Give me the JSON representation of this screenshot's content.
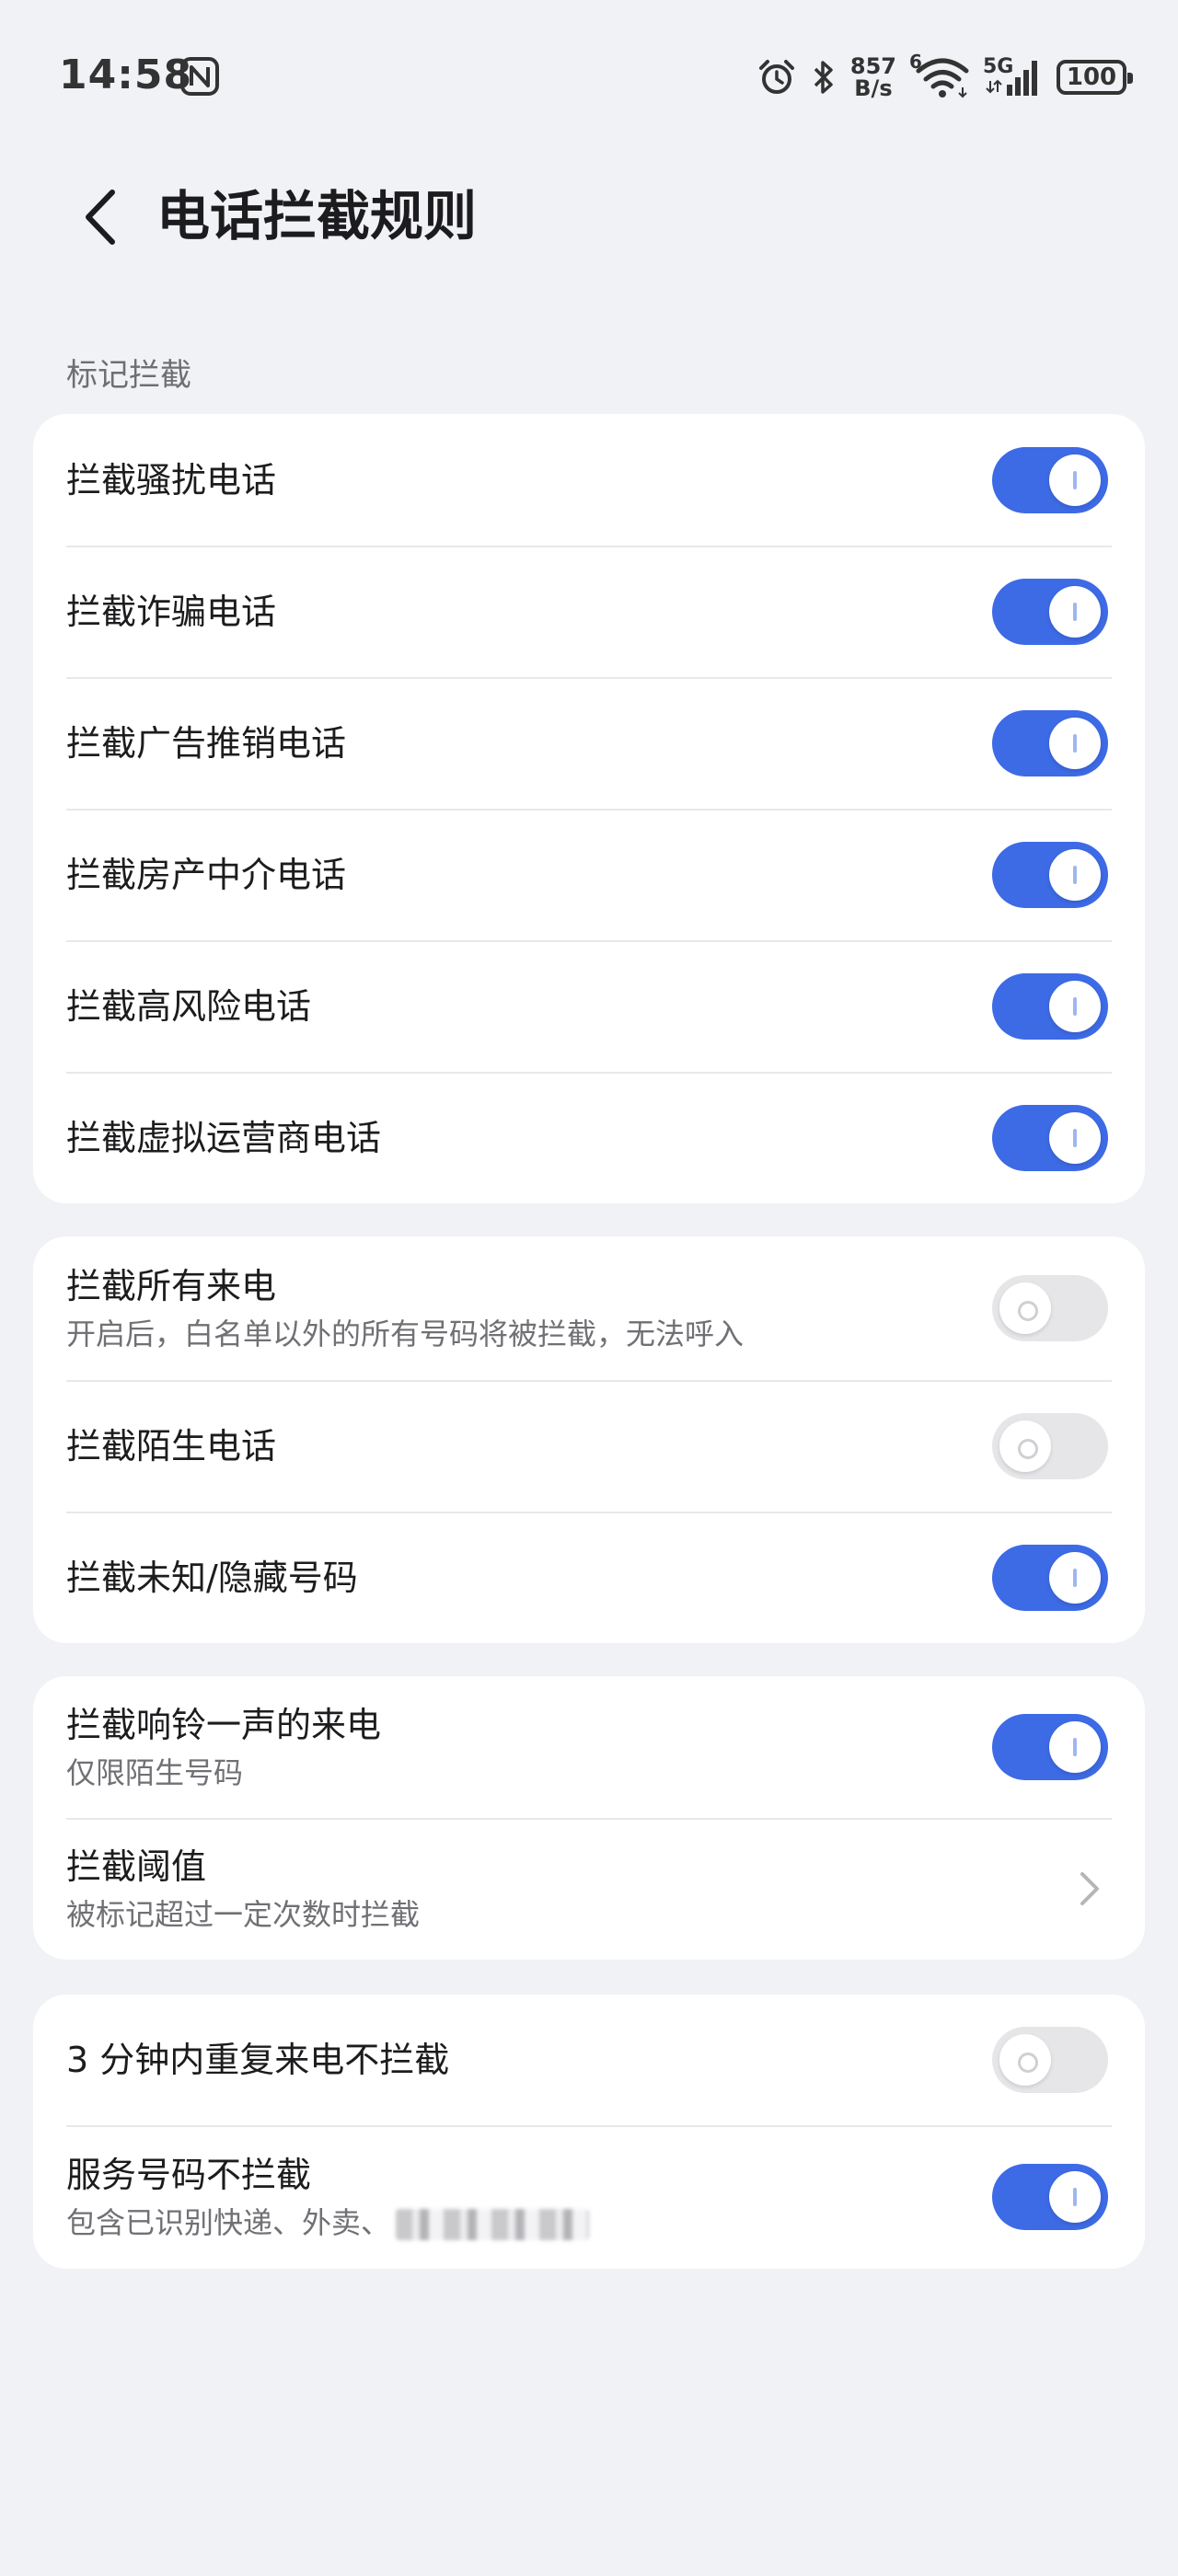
{
  "status_bar": {
    "time": "14:58",
    "net_speed_value": "857",
    "net_speed_unit": "B/s",
    "wifi_badge": "6",
    "mobile_badge": "5G",
    "battery": "100"
  },
  "header": {
    "title": "电话拦截规则"
  },
  "section_label": "标记拦截",
  "card1": {
    "items": [
      {
        "label": "拦截骚扰电话",
        "on": true
      },
      {
        "label": "拦截诈骗电话",
        "on": true
      },
      {
        "label": "拦截广告推销电话",
        "on": true
      },
      {
        "label": "拦截房产中介电话",
        "on": true
      },
      {
        "label": "拦截高风险电话",
        "on": true
      },
      {
        "label": "拦截虚拟运营商电话",
        "on": true
      }
    ]
  },
  "card2": {
    "all_calls": {
      "label": "拦截所有来电",
      "sub": "开启后，白名单以外的所有号码将被拦截，无法呼入",
      "on": false
    },
    "strangers": {
      "label": "拦截陌生电话",
      "on": false
    },
    "unknown": {
      "label": "拦截未知/隐藏号码",
      "on": true
    }
  },
  "card3": {
    "one_ring": {
      "label": "拦截响铃一声的来电",
      "sub": "仅限陌生号码",
      "on": true
    },
    "threshold": {
      "label": "拦截阈值",
      "sub": "被标记超过一定次数时拦截"
    }
  },
  "card4": {
    "repeat": {
      "label": "3 分钟内重复来电不拦截",
      "on": false
    },
    "service": {
      "label": "服务号码不拦截",
      "sub": "包含已识别快递、外卖、",
      "on": true
    }
  },
  "colors": {
    "accent": "#3d6ae5",
    "background": "#f1f2f6",
    "card": "#ffffff"
  }
}
